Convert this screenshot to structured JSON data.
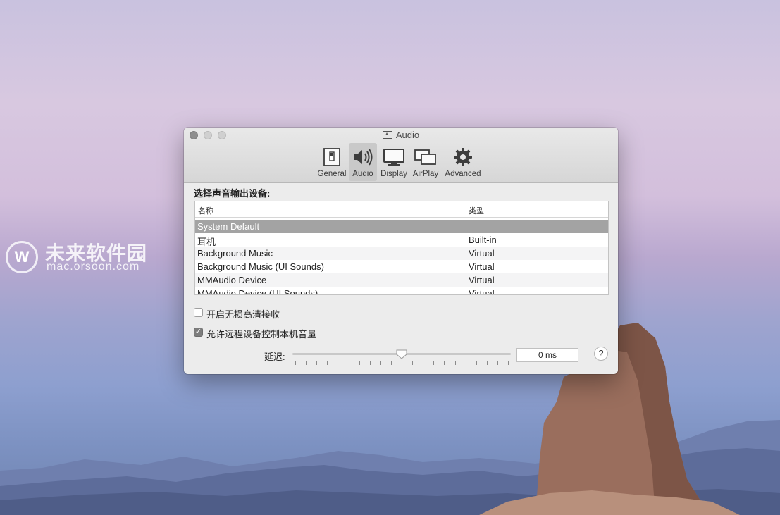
{
  "watermark": {
    "logo": "W",
    "title": "未来软件园",
    "url": "mac.orsoon.com"
  },
  "window": {
    "title": "Audio",
    "tabs": [
      {
        "label": "General",
        "icon": "switch-icon"
      },
      {
        "label": "Audio",
        "icon": "speaker-icon",
        "selected": true
      },
      {
        "label": "Display",
        "icon": "monitor-icon"
      },
      {
        "label": "AirPlay",
        "icon": "airplay-icon"
      },
      {
        "label": "Advanced",
        "icon": "gear-icon"
      }
    ],
    "section_label": "选择声音输出设备:",
    "table": {
      "columns": [
        "名称",
        "类型"
      ],
      "rows": [
        {
          "name": "System Default",
          "type": ""
        },
        {
          "name": "耳机",
          "type": "Built-in"
        },
        {
          "name": "Background Music",
          "type": "Virtual"
        },
        {
          "name": "Background Music (UI Sounds)",
          "type": "Virtual"
        },
        {
          "name": "MMAudio Device",
          "type": "Virtual"
        },
        {
          "name": "MMAudio Device (UI Sounds)",
          "type": "Virtual"
        }
      ]
    },
    "checkboxes": [
      {
        "label": "开启无损高清接收",
        "checked": false
      },
      {
        "label": "允许远程设备控制本机音量",
        "checked": true
      }
    ],
    "delay": {
      "label": "延迟:",
      "value_text": "0 ms",
      "slider_fraction": 0.5
    },
    "help_label": "?"
  }
}
